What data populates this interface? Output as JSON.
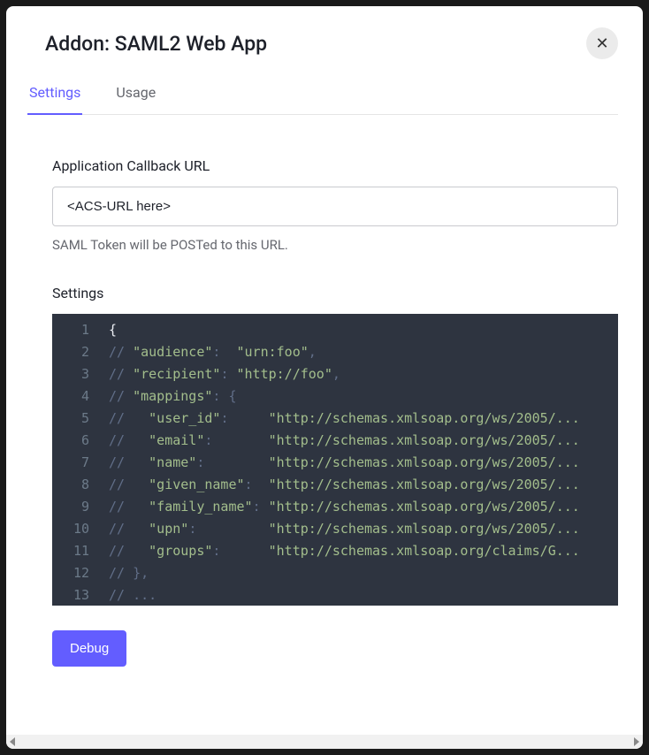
{
  "modal": {
    "title": "Addon: SAML2 Web App"
  },
  "tabs": {
    "settings": "Settings",
    "usage": "Usage"
  },
  "form": {
    "callback_label": "Application Callback URL",
    "callback_value": "<ACS-URL here>",
    "callback_help": "SAML Token will be POSTed to this URL.",
    "settings_label": "Settings"
  },
  "editor": {
    "lines": [
      {
        "n": 1,
        "tokens": [
          [
            "brace",
            "{"
          ]
        ]
      },
      {
        "n": 2,
        "tokens": [
          [
            "comment",
            "// "
          ],
          [
            "string",
            "\"audience\""
          ],
          [
            "comment",
            ":  "
          ],
          [
            "string",
            "\"urn:foo\""
          ],
          [
            "comment",
            ","
          ]
        ]
      },
      {
        "n": 3,
        "tokens": [
          [
            "comment",
            "// "
          ],
          [
            "string",
            "\"recipient\""
          ],
          [
            "comment",
            ": "
          ],
          [
            "string",
            "\"http://foo\""
          ],
          [
            "comment",
            ","
          ]
        ]
      },
      {
        "n": 4,
        "tokens": [
          [
            "comment",
            "// "
          ],
          [
            "string",
            "\"mappings\""
          ],
          [
            "comment",
            ": {"
          ]
        ]
      },
      {
        "n": 5,
        "tokens": [
          [
            "comment",
            "//   "
          ],
          [
            "string",
            "\"user_id\""
          ],
          [
            "comment",
            ":     "
          ],
          [
            "string",
            "\"http://schemas.xmlsoap.org/ws/2005/..."
          ]
        ]
      },
      {
        "n": 6,
        "tokens": [
          [
            "comment",
            "//   "
          ],
          [
            "string",
            "\"email\""
          ],
          [
            "comment",
            ":       "
          ],
          [
            "string",
            "\"http://schemas.xmlsoap.org/ws/2005/..."
          ]
        ]
      },
      {
        "n": 7,
        "tokens": [
          [
            "comment",
            "//   "
          ],
          [
            "string",
            "\"name\""
          ],
          [
            "comment",
            ":        "
          ],
          [
            "string",
            "\"http://schemas.xmlsoap.org/ws/2005/..."
          ]
        ]
      },
      {
        "n": 8,
        "tokens": [
          [
            "comment",
            "//   "
          ],
          [
            "string",
            "\"given_name\""
          ],
          [
            "comment",
            ":  "
          ],
          [
            "string",
            "\"http://schemas.xmlsoap.org/ws/2005/..."
          ]
        ]
      },
      {
        "n": 9,
        "tokens": [
          [
            "comment",
            "//   "
          ],
          [
            "string",
            "\"family_name\""
          ],
          [
            "comment",
            ": "
          ],
          [
            "string",
            "\"http://schemas.xmlsoap.org/ws/2005/..."
          ]
        ]
      },
      {
        "n": 10,
        "tokens": [
          [
            "comment",
            "//   "
          ],
          [
            "string",
            "\"upn\""
          ],
          [
            "comment",
            ":         "
          ],
          [
            "string",
            "\"http://schemas.xmlsoap.org/ws/2005/..."
          ]
        ]
      },
      {
        "n": 11,
        "tokens": [
          [
            "comment",
            "//   "
          ],
          [
            "string",
            "\"groups\""
          ],
          [
            "comment",
            ":      "
          ],
          [
            "string",
            "\"http://schemas.xmlsoap.org/claims/G..."
          ]
        ]
      },
      {
        "n": 12,
        "tokens": [
          [
            "comment",
            "// },"
          ]
        ]
      },
      {
        "n": 13,
        "tokens": [
          [
            "comment",
            "// ..."
          ]
        ]
      }
    ]
  },
  "buttons": {
    "debug": "Debug"
  }
}
